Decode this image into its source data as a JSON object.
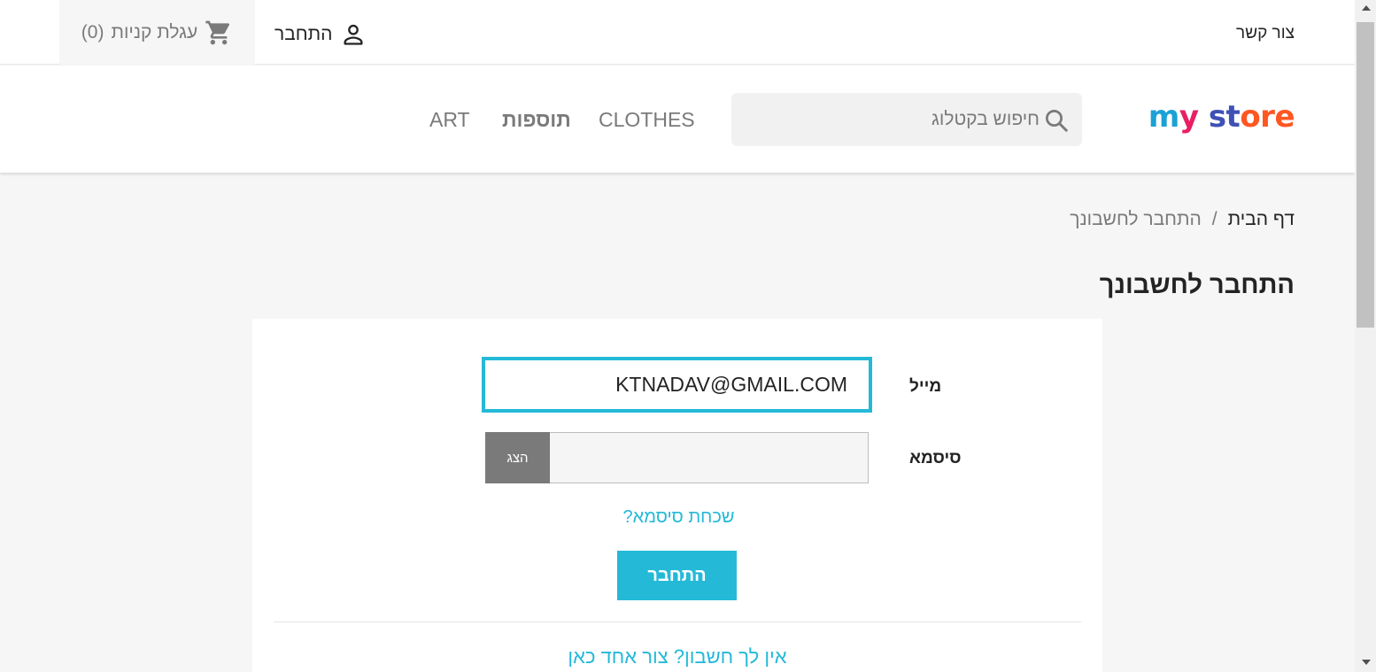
{
  "topbar": {
    "contact_label": "צור קשר",
    "login_label": "התחבר",
    "cart_label": "עגלת קניות",
    "cart_count": "(0)"
  },
  "header": {
    "logo": {
      "part1": "m",
      "part2": "y",
      "part3": " st",
      "part4": "ore"
    },
    "search": {
      "placeholder": "חיפוש בקטלוג"
    },
    "nav": {
      "clothes": "CLOTHES",
      "extras": "תוספות",
      "art": "ART"
    }
  },
  "breadcrumb": {
    "home": "דף הבית",
    "separator": "/",
    "current": "התחבר לחשבונך"
  },
  "page_title": "התחבר לחשבונך",
  "login_form": {
    "email_label": "מייל",
    "email_value": "KTNADAV@GMAIL.COM",
    "password_label": "סיסמא",
    "show_button": "הצג",
    "forgot_link": "שכחת סיסמא?",
    "submit_button": "התחבר",
    "signup_link": "אין לך חשבון? צור אחד כאן"
  },
  "colors": {
    "accent": "#24b9d7",
    "text": "#232323",
    "muted": "#7a7a7a",
    "page_background": "#f6f6f6"
  },
  "icons": {
    "user": "user-icon",
    "cart": "cart-icon",
    "search": "search-icon"
  }
}
